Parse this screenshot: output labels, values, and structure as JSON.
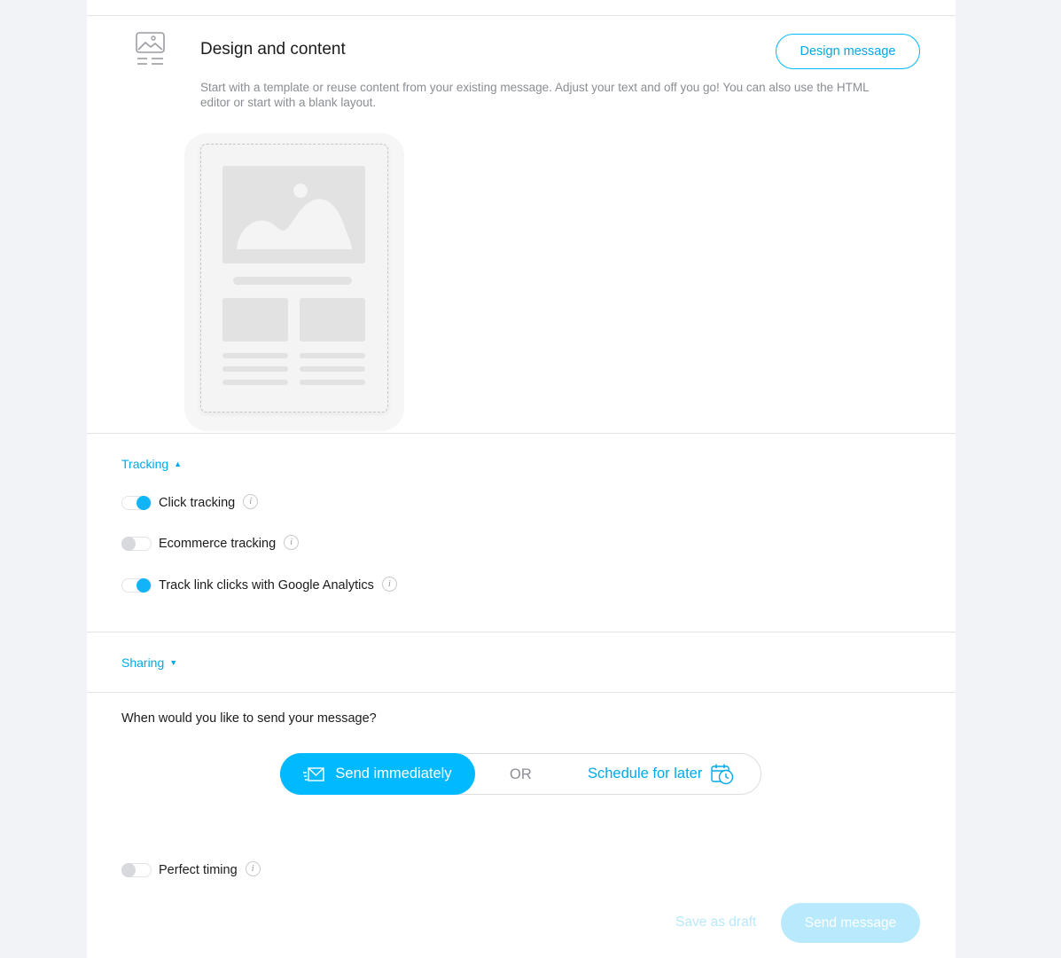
{
  "design": {
    "title": "Design and content",
    "button": "Design message",
    "description": "Start with a template or reuse content from your existing message. Adjust your text and off you go! You can also use the HTML editor or start with a blank layout."
  },
  "tracking": {
    "label": "Tracking",
    "expanded": true,
    "options": [
      {
        "label": "Click tracking",
        "enabled": true
      },
      {
        "label": "Ecommerce tracking",
        "enabled": false
      },
      {
        "label": "Track link clicks with Google Analytics",
        "enabled": true
      }
    ]
  },
  "sharing": {
    "label": "Sharing",
    "expanded": false
  },
  "send": {
    "question": "When would you like to send your message?",
    "immediately": "Send immediately",
    "or": "OR",
    "schedule": "Schedule for later"
  },
  "perfect_timing": {
    "label": "Perfect timing",
    "enabled": false
  },
  "footer": {
    "save_draft": "Save as draft",
    "send": "Send message"
  },
  "colors": {
    "accent": "#00b9ff",
    "link": "#00a9ea",
    "muted": "#8a8d93",
    "page_bg": "#f2f3f7"
  }
}
